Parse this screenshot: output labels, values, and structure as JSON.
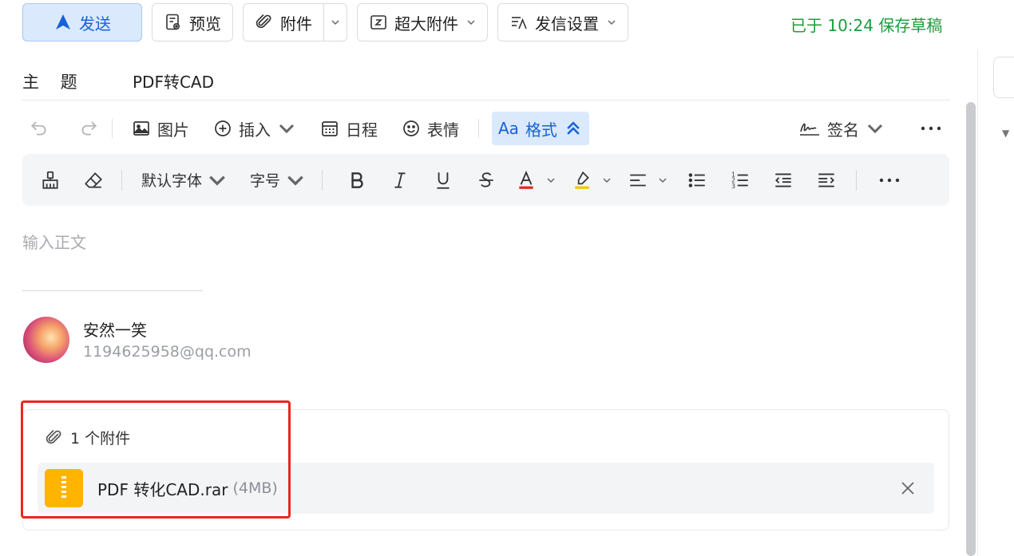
{
  "topbar": {
    "send_label": "发送",
    "preview_label": "预览",
    "attach_label": "附件",
    "big_attach_label": "超大附件",
    "send_settings_label": "发信设置",
    "saved_status": "已于 10:24 保存草稿"
  },
  "subject": {
    "label": "主 题",
    "value": "PDF转CAD"
  },
  "toolbar": {
    "image_label": "图片",
    "insert_label": "插入",
    "schedule_label": "日程",
    "emoji_label": "表情",
    "format_label": "格式",
    "format_prefix": "Aa",
    "signature_label": "签名"
  },
  "format_bar": {
    "font_family": "默认字体",
    "font_size": "字号"
  },
  "body": {
    "placeholder": "输入正文"
  },
  "signature": {
    "name": "安然一笑",
    "email": "1194625958@qq.com"
  },
  "attachments": {
    "heading": "1 个附件",
    "items": [
      {
        "name": "PDF 转化CAD.rar",
        "size": "(4MB)"
      }
    ]
  },
  "colors": {
    "accent": "#1662d8",
    "saved_green": "#1b9e3b",
    "highlight_red": "#e8281e",
    "archive_yellow": "#ffb400"
  }
}
